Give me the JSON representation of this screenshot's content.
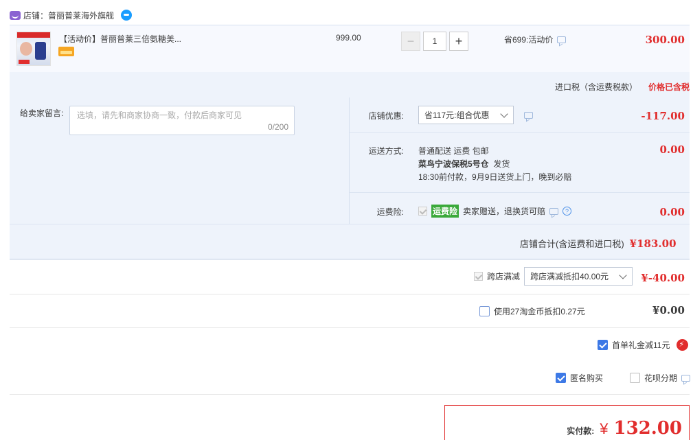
{
  "store": {
    "name": "店铺：普丽普莱海外旗舰"
  },
  "item": {
    "title": "【活动价】普丽普莱三倍氨糖美...",
    "price": "999.00",
    "quantity": "1",
    "promo": "省699:活动价",
    "subtotal": "300.00"
  },
  "tax": {
    "label": "进口税（含运费税款）",
    "status": "价格已含税"
  },
  "message": {
    "label": "给卖家留言:",
    "placeholder": "选填，请先和商家协商一致，付款后商家可见",
    "count": "0/200"
  },
  "coupon": {
    "label": "店铺优惠:",
    "selected": "省117元:组合优惠",
    "value": "-117.00"
  },
  "shipping": {
    "label": "运送方式:",
    "line1": "普通配送 运费 包邮",
    "warehouse": "菜鸟宁波保税5号仓",
    "dispatch": "发货",
    "line3": "18:30前付款，9月9日送货上门，晚到必赔",
    "value": "0.00"
  },
  "insurance": {
    "label": "运费险:",
    "badge": "运费险",
    "text": "卖家赠送，退换货可赔",
    "value": "0.00"
  },
  "store_total": {
    "label": "店铺合计(含运费和进口税)",
    "value": "¥183.00"
  },
  "cross_store": {
    "label": "跨店满减",
    "selected": "跨店满减抵扣40.00元",
    "value": "¥-40.00"
  },
  "taobao_coins": {
    "label": "使用27淘金币抵扣0.27元",
    "value": "¥0.00"
  },
  "first_order": {
    "label": "首单礼金减11元"
  },
  "anonymous": {
    "label": "匿名购买"
  },
  "huabei": {
    "label": "花呗分期"
  },
  "payment": {
    "label": "实付款:",
    "currency": "¥",
    "value": "132.00"
  },
  "colors": {
    "accent_red": "#e12d2d",
    "accent_blue": "#3d79e6",
    "panel_bg": "#eef3fb",
    "insurance_green": "#3aa93a"
  }
}
